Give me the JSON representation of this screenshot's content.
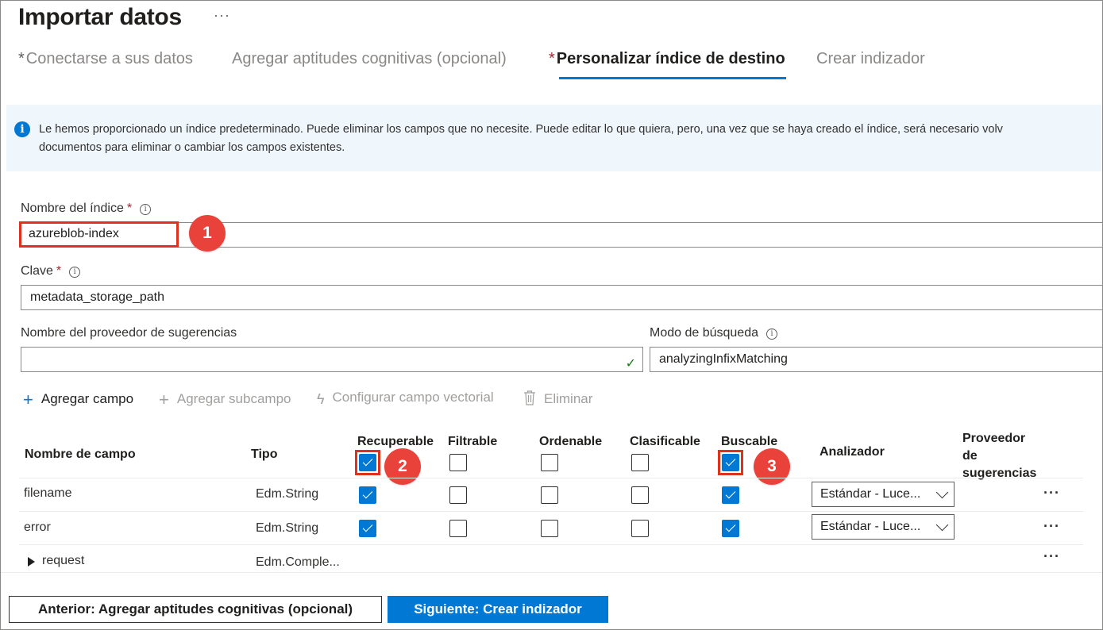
{
  "header": {
    "title": "Importar datos",
    "more": "···"
  },
  "tabs": [
    {
      "required": "*",
      "label": "Conectarse a sus datos"
    },
    {
      "required": "",
      "label": "Agregar aptitudes cognitivas (opcional)"
    },
    {
      "required": "*",
      "label": "Personalizar índice de destino",
      "active": true
    },
    {
      "required": "",
      "label": "Crear indizador"
    }
  ],
  "info": {
    "line1": "Le hemos proporcionado un índice predeterminado. Puede eliminar los campos que no necesite. Puede editar lo que quiera, pero, una vez que se haya creado el índice, será necesario volv",
    "line2": "documentos para eliminar o cambiar los campos existentes."
  },
  "form": {
    "index_name_label": "Nombre del índice",
    "index_name_value": "azureblob-index",
    "key_label": "Clave",
    "key_value": "metadata_storage_path",
    "suggester_label": "Nombre del proveedor de sugerencias",
    "suggester_value": "",
    "search_mode_label": "Modo de búsqueda",
    "search_mode_value": "analyzingInfixMatching",
    "required_mark": "*",
    "info_glyph": "i"
  },
  "badges": [
    "1",
    "2",
    "3"
  ],
  "toolbar": {
    "add_field": "Agregar campo",
    "add_subfield": "Agregar subcampo",
    "configure_vector": "Configurar campo vectorial",
    "delete": "Eliminar"
  },
  "table": {
    "headers": {
      "field_name": "Nombre de campo",
      "type": "Tipo",
      "retrievable": "Recuperable",
      "filterable": "Filtrable",
      "sortable": "Ordenable",
      "facetable": "Clasificable",
      "searchable": "Buscable",
      "analyzer": "Analizador",
      "suggester_1": "Proveedor",
      "suggester_2": "de",
      "suggester_3": "sugerencias"
    },
    "header_checks": {
      "retrievable": true,
      "filterable": false,
      "sortable": false,
      "facetable": false,
      "searchable": true
    },
    "rows": [
      {
        "name": "filename",
        "type": "Edm.String",
        "retrievable": true,
        "filterable": false,
        "sortable": false,
        "facetable": false,
        "searchable": true,
        "analyzer": "Estándar - Luce...",
        "more": "···"
      },
      {
        "name": "error",
        "type": "Edm.String",
        "retrievable": true,
        "filterable": false,
        "sortable": false,
        "facetable": false,
        "searchable": true,
        "analyzer": "Estándar - Luce...",
        "more": "···"
      },
      {
        "name": "request",
        "type": "Edm.Comple...",
        "expandable": true,
        "more": "···"
      }
    ]
  },
  "footer": {
    "previous": "Anterior: Agregar aptitudes cognitivas (opcional)",
    "next": "Siguiente: Crear indizador"
  },
  "colors": {
    "accent": "#0078d4",
    "highlight": "#e0301e",
    "badge": "#e8423a",
    "required": "#a4262c",
    "info_bg": "#eff6fc"
  },
  "icons": {
    "info": "info-circle-icon",
    "add": "plus-icon",
    "vector": "lightning-icon",
    "delete": "trash-icon",
    "valid": "checkmark-icon",
    "chevron": "chevron-down-icon"
  }
}
